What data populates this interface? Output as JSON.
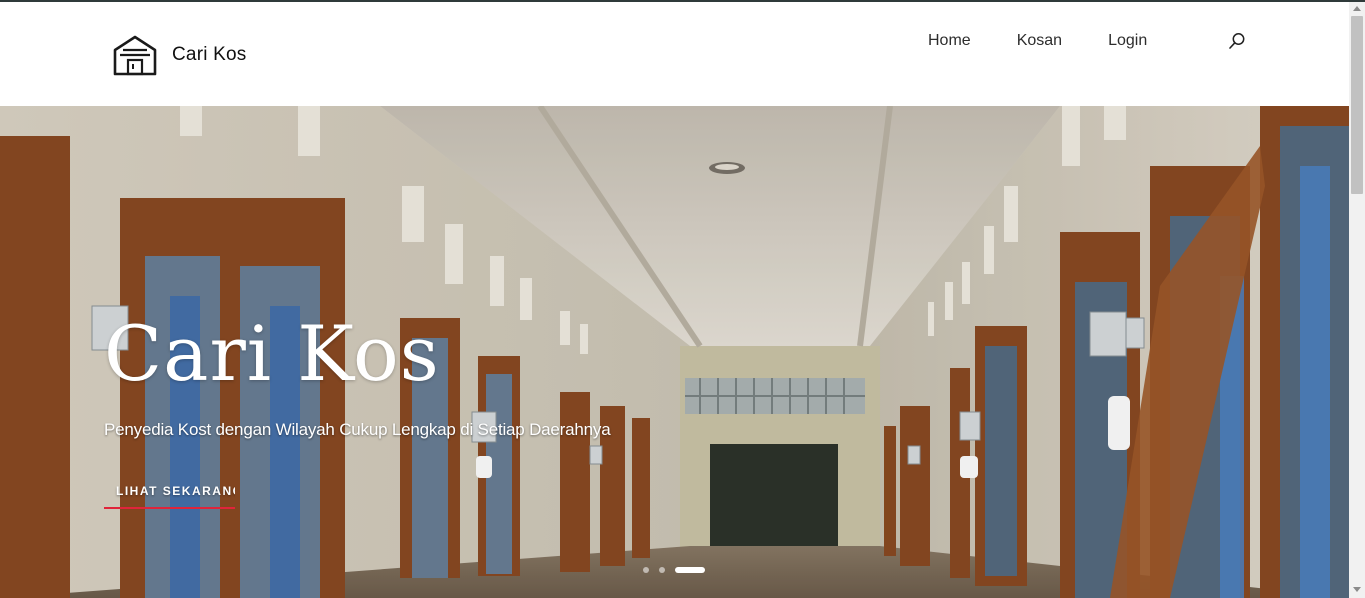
{
  "brand": {
    "name": "Cari Kos",
    "logo_icon": "house-outline-icon"
  },
  "nav": {
    "items": [
      "Home",
      "Kosan",
      "Login"
    ],
    "search_icon": "search-icon"
  },
  "hero": {
    "title": "Cari Kos",
    "subtitle": "Penyedia Kost dengan Wilayah Cukup Lengkap di Setiap Daerahnya",
    "cta_label": "LIHAT SEKARANG",
    "slides_total": 3,
    "active_slide": 3,
    "accent_color": "#e0243a"
  }
}
